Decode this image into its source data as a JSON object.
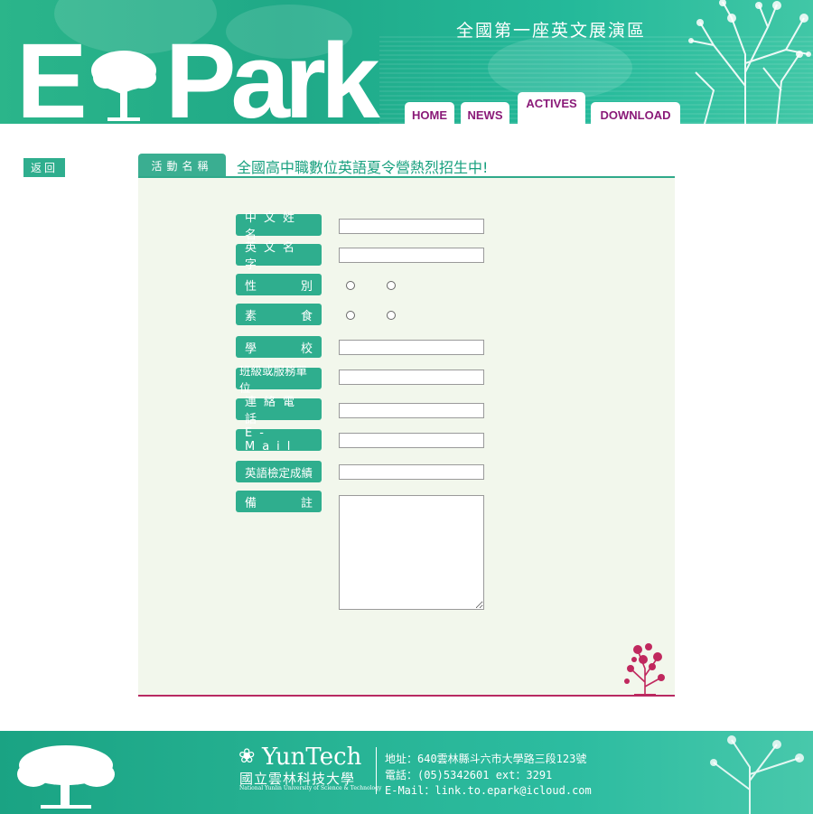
{
  "header": {
    "tagline": "全國第一座英文展演區",
    "logo_letter_1": "E",
    "logo_word": "Park"
  },
  "nav": {
    "tabs": [
      {
        "label": "HOME",
        "active": false
      },
      {
        "label": "NEWS",
        "active": false
      },
      {
        "label": "ACTIVES",
        "active": true
      },
      {
        "label": "DOWNLOAD",
        "active": false
      }
    ]
  },
  "back_label": "返回",
  "activity": {
    "tab_label": "活動名稱",
    "title": "全國高中職數位英語夏令營熱烈招生中!"
  },
  "form": {
    "chinese_name_label": "中文姓名",
    "english_name_label": "英文名字",
    "gender_label_1": "性",
    "gender_label_2": "別",
    "vegetarian_label_1": "素",
    "vegetarian_label_2": "食",
    "school_label_1": "學",
    "school_label_2": "校",
    "unit_label": "班級或服務單位",
    "phone_label": "連絡電話",
    "email_label": "E-Mail",
    "english_cert_label": "英語檢定成績",
    "remarks_label_1": "備",
    "remarks_label_2": "註"
  },
  "footer": {
    "uni_name": "YunTech",
    "uni_cn": "國立雲林科技大學",
    "uni_en": "National Yunlin University of Science & Technology",
    "address": "地址：640雲林縣斗六市大學路三段123號",
    "phone": "電話：(05)5342601 ext：3291",
    "email": "E-Mail：link.to.epark@icloud.com"
  },
  "colors": {
    "brand_green": "#2fae8e",
    "nav_text": "#8a1a78",
    "accent_magenta": "#b82a62"
  }
}
